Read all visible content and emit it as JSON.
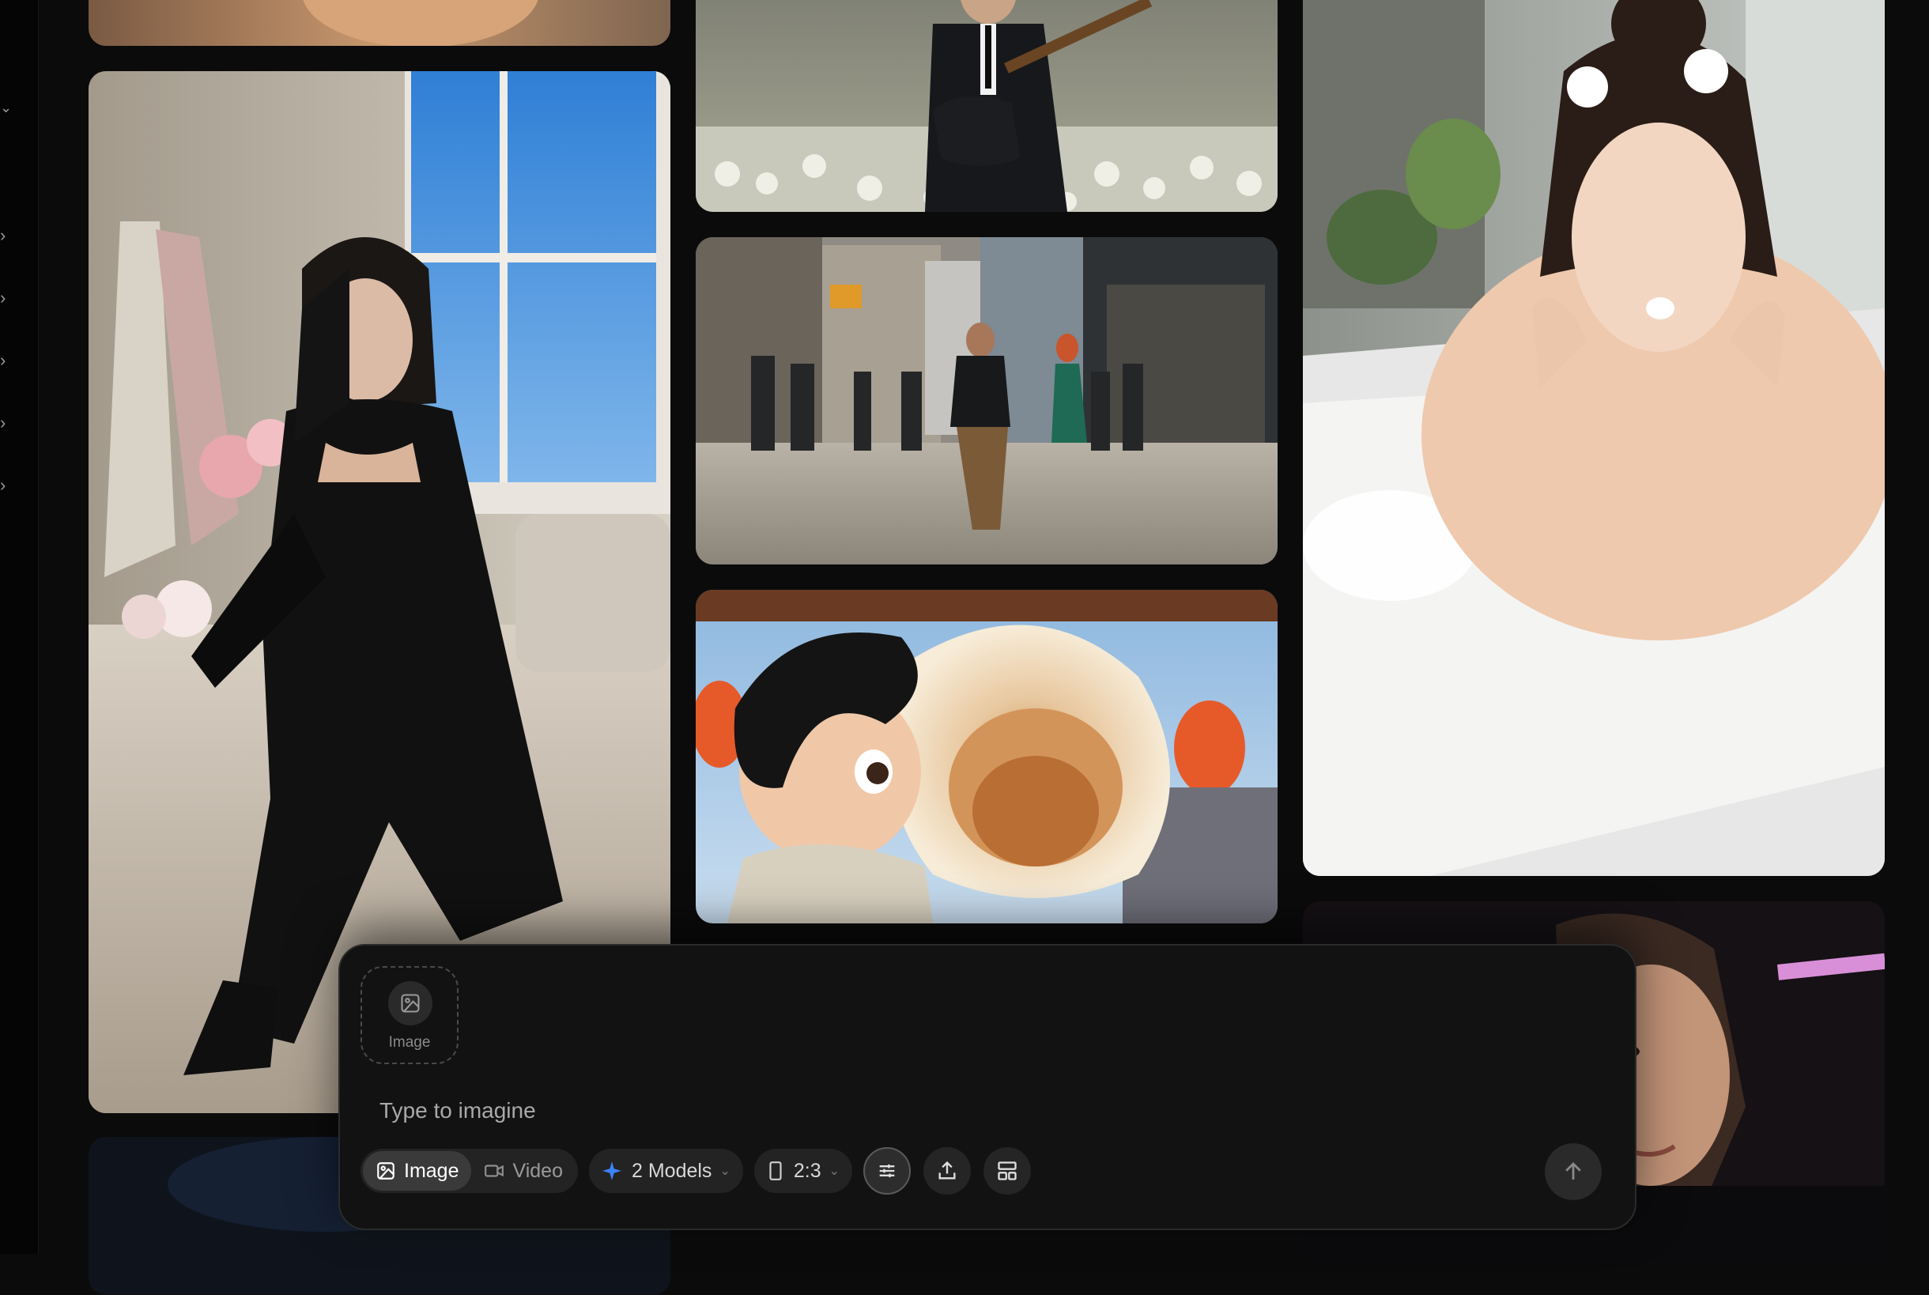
{
  "sidebar": {
    "chevrons": [
      "chevron-right",
      "chevron-right",
      "chevron-right",
      "chevron-right",
      "chevron-right",
      "chevron-right"
    ]
  },
  "gallery": {
    "tiles": [
      {
        "name": "partial-top-left"
      },
      {
        "name": "woman-black-dress-bedroom"
      },
      {
        "name": "man-playing-guitar-flower-field"
      },
      {
        "name": "city-street-crowd"
      },
      {
        "name": "animated-boy-dumpling"
      },
      {
        "name": "woman-in-bathtub"
      },
      {
        "name": "woman-in-car-night"
      },
      {
        "name": "partial-bottom-left"
      }
    ]
  },
  "composer": {
    "upload_label": "Image",
    "prompt_placeholder": "Type to imagine",
    "mode_options": [
      {
        "label": "Image",
        "icon": "image-icon",
        "active": true
      },
      {
        "label": "Video",
        "icon": "video-icon",
        "active": false
      }
    ],
    "models_label": "2 Models",
    "aspect_label": "2:3",
    "accent_color": "#3b82f6"
  }
}
